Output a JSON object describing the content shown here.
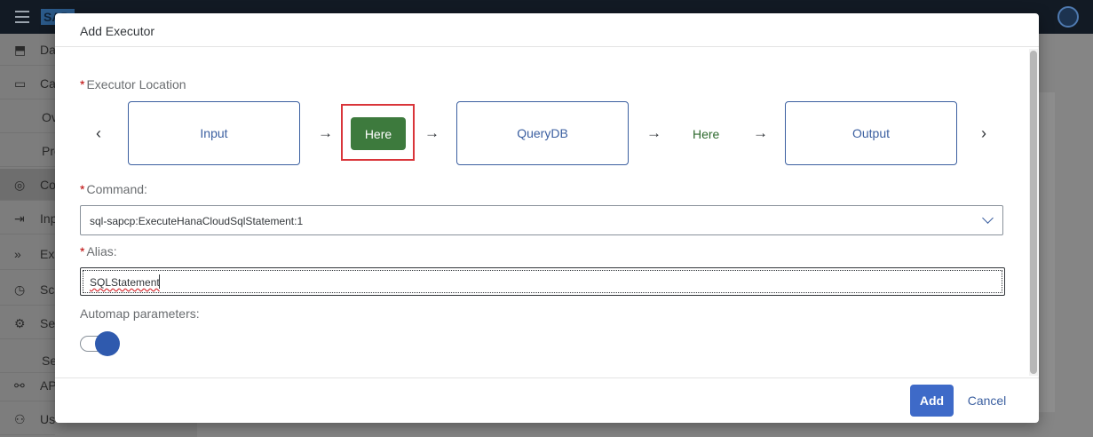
{
  "background": {
    "logo_text": "SAP",
    "nav_items": [
      {
        "icon": "⬒",
        "label": "Dashboard"
      },
      {
        "icon": "▭",
        "label": "Catalog"
      },
      {
        "icon": "",
        "label": "Overview"
      },
      {
        "icon": "",
        "label": "Processes"
      },
      {
        "icon": "◎",
        "label": "Commands"
      },
      {
        "icon": "⇥",
        "label": "Inputs"
      },
      {
        "icon": "»",
        "label": "Executors"
      },
      {
        "icon": "◷",
        "label": "Schedules"
      },
      {
        "icon": "⚙",
        "label": "Settings"
      },
      {
        "icon": "",
        "label": "Service"
      },
      {
        "icon": "⚯",
        "label": "API"
      },
      {
        "icon": "⚇",
        "label": "Users"
      }
    ]
  },
  "dialog": {
    "title": "Add Executor",
    "executor_location": {
      "label": "Executor Location",
      "steps": {
        "input": "Input",
        "here_selected": "Here",
        "querydb": "QueryDB",
        "here_option": "Here",
        "output": "Output"
      }
    },
    "command": {
      "label": "Command:",
      "value": "sql-sapcp:ExecuteHanaCloudSqlStatement:1"
    },
    "alias": {
      "label": "Alias:",
      "value": "SQLStatement"
    },
    "automap": {
      "label": "Automap parameters:",
      "enabled": true
    },
    "buttons": {
      "add": "Add",
      "cancel": "Cancel"
    }
  },
  "colors": {
    "accent": "#3e6ac8",
    "here_button": "#3d7a3d",
    "highlight_frame": "#d9353a",
    "required": "#bb0000"
  }
}
